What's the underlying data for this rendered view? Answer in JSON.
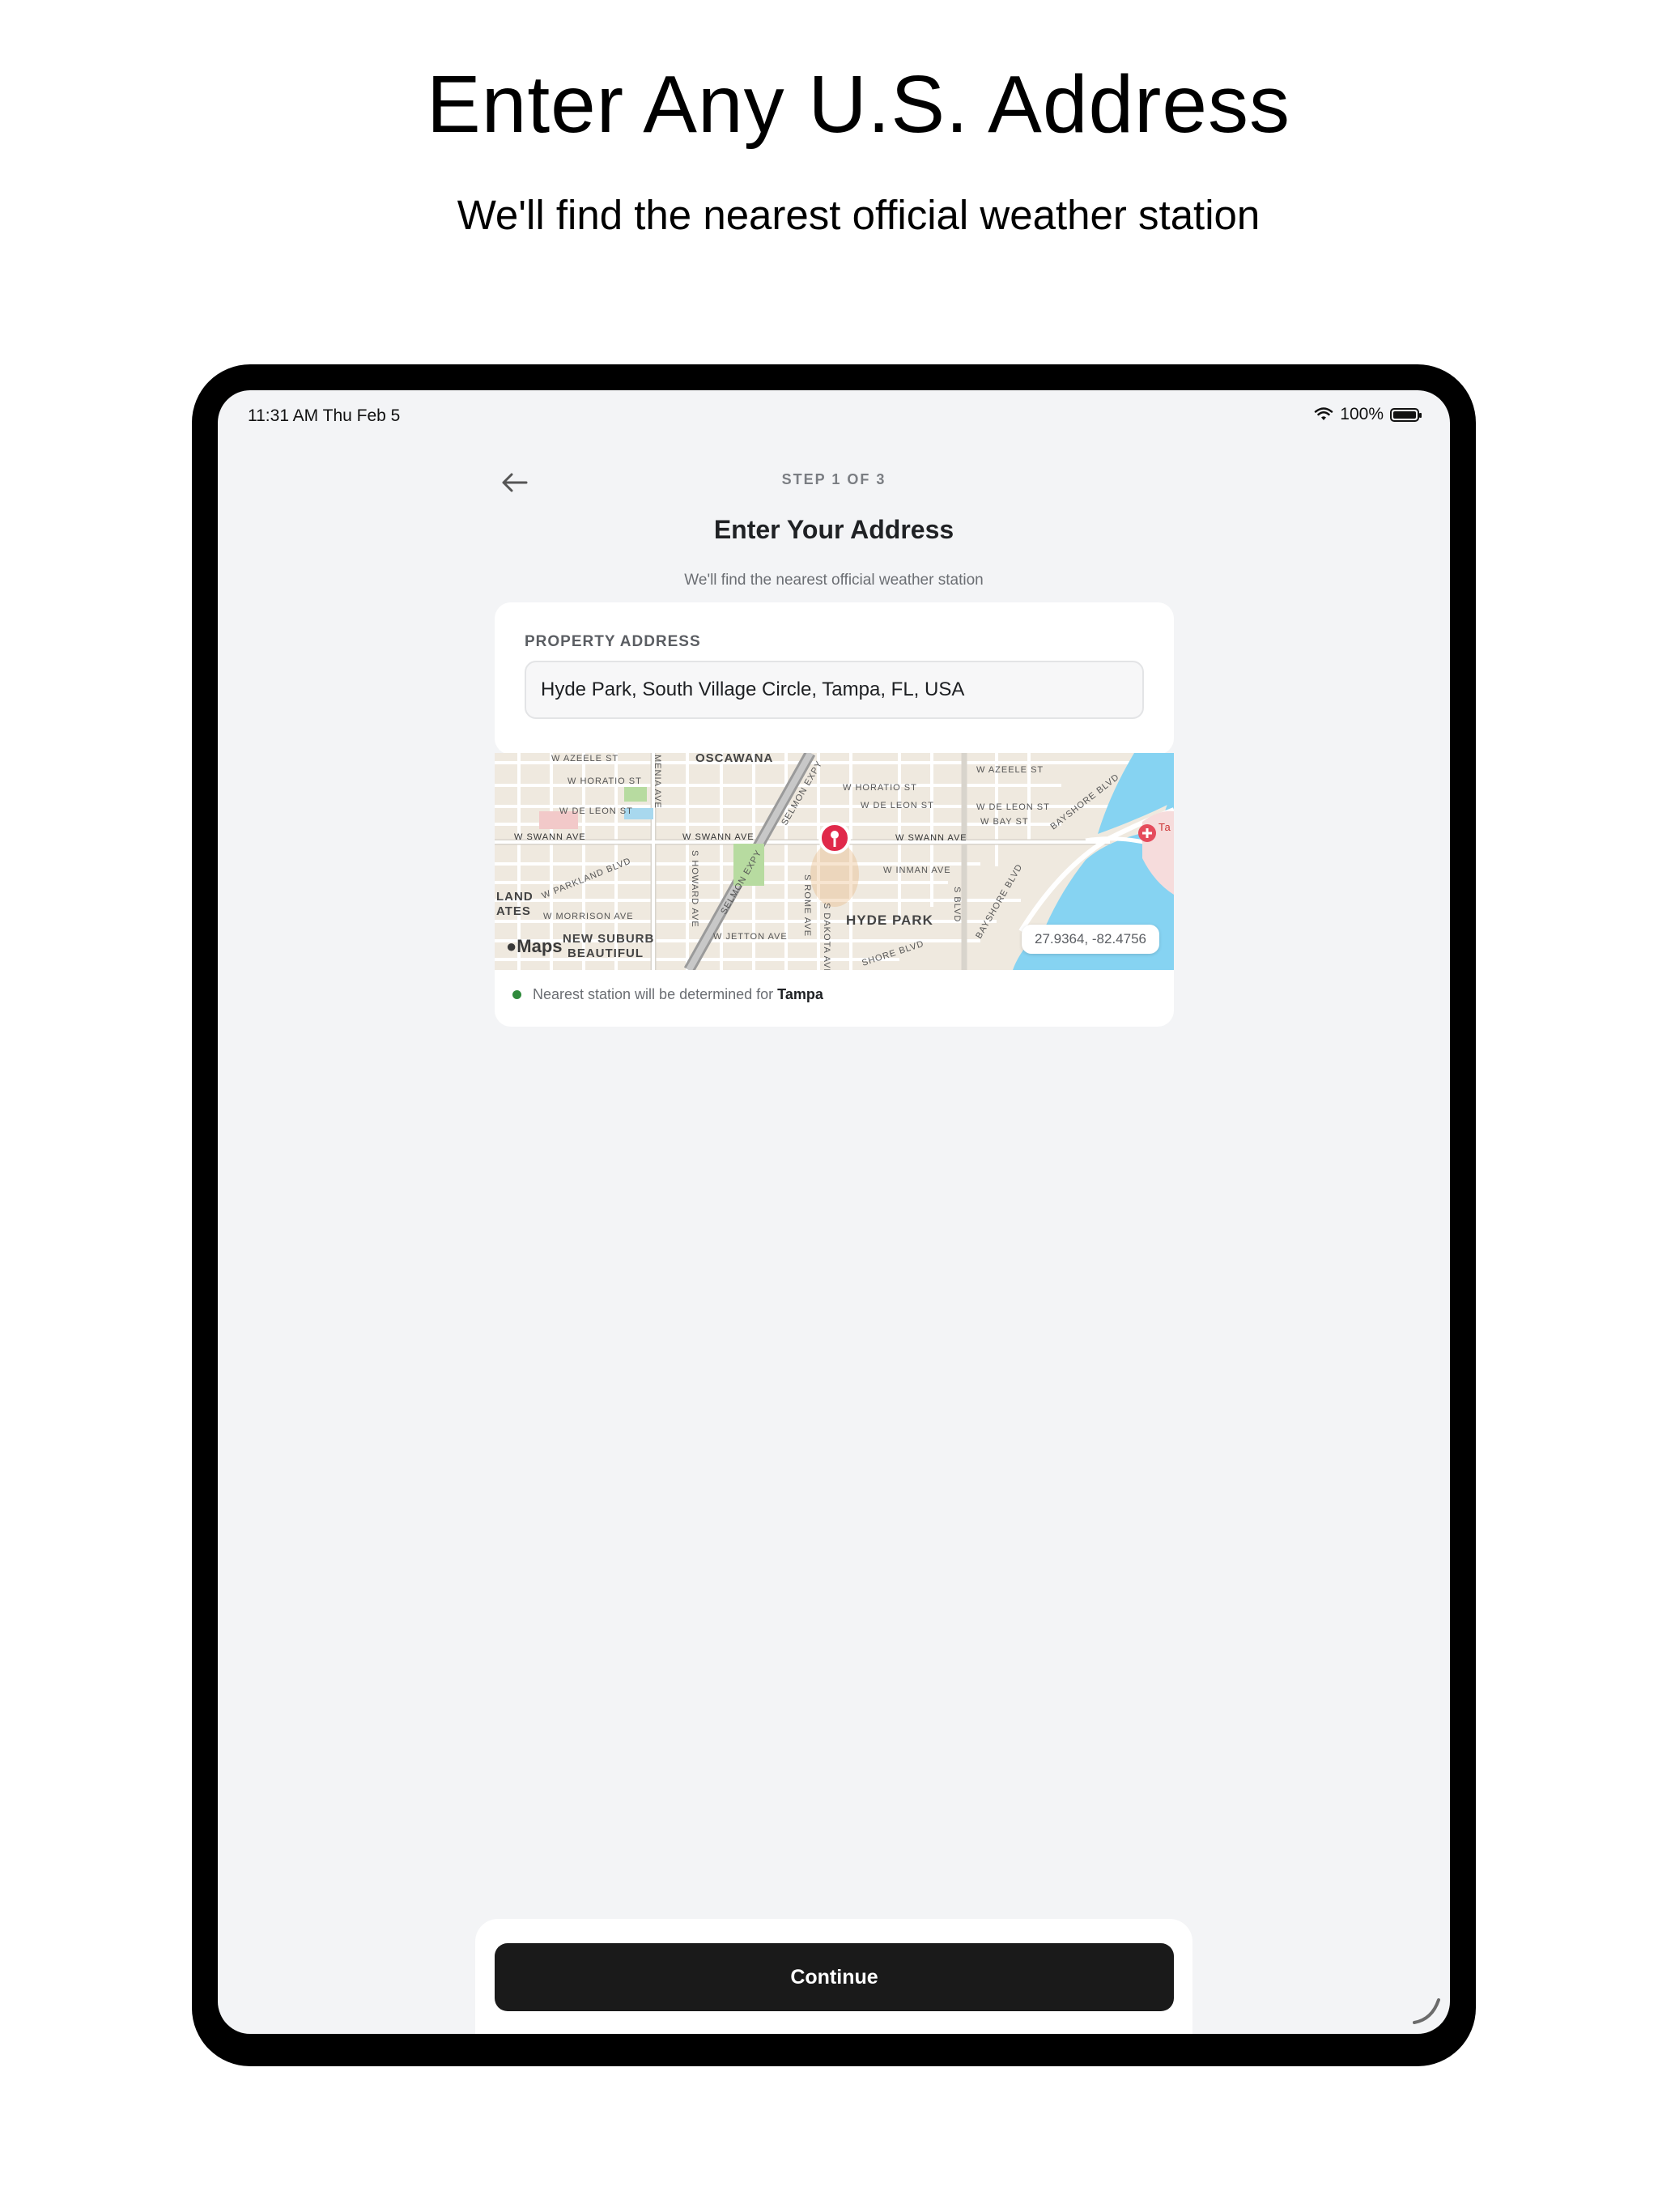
{
  "promo": {
    "title": "Enter Any U.S. Address",
    "subtitle": "We'll find the nearest official weather station"
  },
  "status_bar": {
    "time_date": "11:31 AM   Thu Feb 5",
    "battery": "100%"
  },
  "header": {
    "step": "STEP 1 OF 3",
    "title": "Enter Your Address",
    "subtitle": "We'll find the nearest official weather station"
  },
  "address_form": {
    "label": "PROPERTY ADDRESS",
    "value": "Hyde Park, South Village Circle, Tampa, FL, USA"
  },
  "map": {
    "provider": "Maps",
    "coordinates": "27.9364, -82.4756",
    "labels": {
      "oscawana": "OSCAWANA",
      "hyde_park": "HYDE PARK",
      "new_suburb": "NEW SUBURB",
      "beautiful": "BEAUTIFUL",
      "land": "LAND",
      "ates": "ATES",
      "w_azeele": "W AZEELE ST",
      "w_azeele2": "W AZEELE ST",
      "w_horatio": "W HORATIO ST",
      "w_horatio2": "W HORATIO ST",
      "w_de_leon": "W DE LEON ST",
      "w_de_leon2": "W DE LEON ST",
      "w_de_leon3": "W DE LEON ST",
      "w_bay": "W BAY ST",
      "w_swann": "W SWANN AVE",
      "w_swann2": "W SWANN AVE",
      "w_swann3": "W SWANN AVE",
      "w_inman": "W INMAN AVE",
      "w_morrison": "W MORRISON AVE",
      "w_jetton": "W JETTON AVE",
      "w_parkland": "W PARKLAND BLVD",
      "selmon": "SELMON EXPY",
      "selmon2": "SELMON EXPY",
      "bayshore": "BAYSHORE BLVD",
      "bayshore2": "BAYSHORE BLVD",
      "bayshore3": "SHORE BLVD",
      "s_howard": "S HOWARD AVE",
      "s_rome": "S ROME AVE",
      "s_dakota": "S DAKOTA AVE",
      "s_blvd": "S BLVD",
      "armenia": "MENIA AVE",
      "hospital": "Ta Ho"
    }
  },
  "station_note": {
    "text": "Nearest station will be determined for",
    "city": "Tampa"
  },
  "footer": {
    "continue_label": "Continue"
  }
}
